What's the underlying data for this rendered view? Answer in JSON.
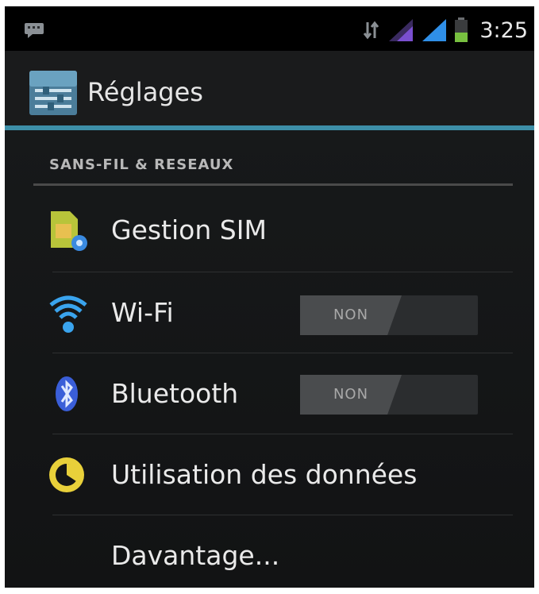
{
  "status_bar": {
    "time": "3:25",
    "icons": [
      "notification-icon",
      "data-transfer-icon",
      "signal-icon",
      "signal-icon",
      "battery-icon"
    ]
  },
  "action_bar": {
    "title": "Réglages",
    "icon": "settings-icon"
  },
  "section": {
    "header": "SANS-FIL & RESEAUX"
  },
  "items": [
    {
      "label": "Gestion SIM",
      "icon": "sim-card-icon"
    },
    {
      "label": "Wi-Fi",
      "icon": "wifi-icon",
      "toggle": "NON"
    },
    {
      "label": "Bluetooth",
      "icon": "bluetooth-icon",
      "toggle": "NON"
    },
    {
      "label": "Utilisation des données",
      "icon": "data-usage-icon"
    },
    {
      "label": "Davantage..."
    }
  ],
  "colors": {
    "accent": "#3d8fa8",
    "background": "#121314",
    "text": "#eaeaea",
    "signal_purple": "#7a4fd0",
    "signal_blue": "#2f8fe8",
    "battery_green": "#78c040",
    "data_usage_yellow": "#e8d03a"
  }
}
